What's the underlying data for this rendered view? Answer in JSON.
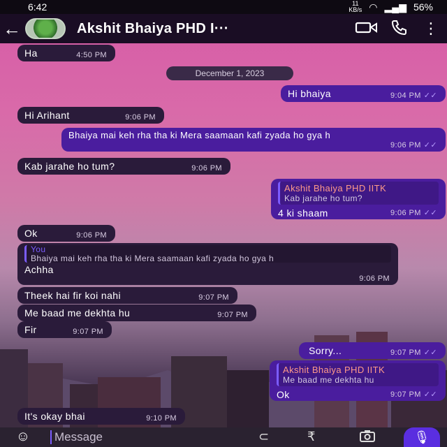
{
  "status": {
    "time": "6:42",
    "speed_top": "11",
    "speed_unit": "KB/s",
    "battery": "56%"
  },
  "header": {
    "contact_name": "Akshit Bhaiya PHD I···"
  },
  "date_chip": "December 1, 2023",
  "messages": [
    {
      "text": "Ha",
      "time": "4:50 PM"
    },
    {
      "text": "Hi bhaiya",
      "time": "9:04 PM"
    },
    {
      "text": "Hi Arihant",
      "time": "9:06 PM"
    },
    {
      "text": "Bhaiya mai keh rha tha ki Mera saamaan kafi zyada ho gya h",
      "time": "9:06 PM"
    },
    {
      "text": "Kab jarahe ho tum?",
      "time": "9:06 PM"
    },
    {
      "quote_name": "Akshit Bhaiya PHD IITK",
      "quote_text": "Kab jarahe ho tum?",
      "text": "4 ki shaam",
      "time": "9:06 PM"
    },
    {
      "text": "Ok",
      "time": "9:06 PM"
    },
    {
      "quote_name": "You",
      "quote_text": "Bhaiya mai keh rha tha ki Mera saamaan kafi zyada ho gya h",
      "text": "Achha",
      "time": "9:06 PM"
    },
    {
      "text": "Theek hai fir koi nahi",
      "time": "9:07 PM"
    },
    {
      "text": "Me baad me dekhta hu",
      "time": "9:07 PM"
    },
    {
      "text": "Fir",
      "time": "9:07 PM"
    },
    {
      "text": "Sorry...",
      "time": "9:07 PM"
    },
    {
      "quote_name": "Akshit Bhaiya PHD IITK",
      "quote_text": "Me baad me dekhta hu",
      "text": "Ok",
      "time": "9:07 PM"
    },
    {
      "text": "It's okay bhai",
      "time": "9:10 PM"
    }
  ],
  "composer": {
    "placeholder": "Message"
  },
  "icons": {
    "back": "arrow-left-icon",
    "video": "video-call-icon",
    "call": "phone-icon",
    "menu": "more-vert-icon",
    "emoji": "emoji-icon",
    "attach": "paperclip-icon",
    "payment": "rupee-icon",
    "camera": "camera-icon",
    "mic": "mic-icon"
  },
  "colors": {
    "incoming_bubble": "#2a1b3a",
    "outgoing_bubble": "#4a1d9e",
    "read_ticks": "#b79cff",
    "app_bar": "#1a0d24"
  }
}
